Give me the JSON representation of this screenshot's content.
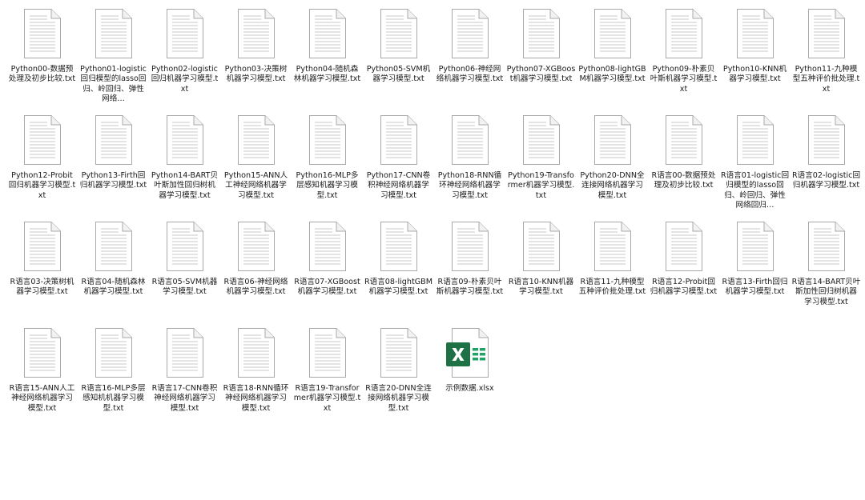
{
  "window": {
    "view": "large-icons"
  },
  "files": [
    {
      "name": "Python00-数据预处理及初步比较.txt",
      "icon": "text-file-icon"
    },
    {
      "name": "Python01-logistic回归模型的lasso回归、岭回归、弹性网络…",
      "icon": "text-file-icon"
    },
    {
      "name": "Python02-logistic回归机器学习模型.txt",
      "icon": "text-file-icon"
    },
    {
      "name": "Python03-决策树机器学习模型.txt",
      "icon": "text-file-icon"
    },
    {
      "name": "Python04-随机森林机器学习模型.txt",
      "icon": "text-file-icon"
    },
    {
      "name": "Python05-SVM机器学习模型.txt",
      "icon": "text-file-icon"
    },
    {
      "name": "Python06-神经网络机器学习模型.txt",
      "icon": "text-file-icon"
    },
    {
      "name": "Python07-XGBoost机器学习模型.txt",
      "icon": "text-file-icon"
    },
    {
      "name": "Python08-lightGBM机器学习模型.txt",
      "icon": "text-file-icon"
    },
    {
      "name": "Python09-朴素贝叶斯机器学习模型.txt",
      "icon": "text-file-icon"
    },
    {
      "name": "Python10-KNN机器学习模型.txt",
      "icon": "text-file-icon"
    },
    {
      "name": "Python11-九种模型五种评价批处理.txt",
      "icon": "text-file-icon"
    },
    {
      "name": "Python12-Probit回归机器学习模型.txt",
      "icon": "text-file-icon"
    },
    {
      "name": "Python13-Firth回归机器学习模型.txt",
      "icon": "text-file-icon"
    },
    {
      "name": "Python14-BART贝叶斯加性回归树机器学习模型.txt",
      "icon": "text-file-icon"
    },
    {
      "name": "Python15-ANN人工神经网络机器学习模型.txt",
      "icon": "text-file-icon"
    },
    {
      "name": "Python16-MLP多层感知机器学习模型.txt",
      "icon": "text-file-icon"
    },
    {
      "name": "Python17-CNN卷积神经网络机器学习模型.txt",
      "icon": "text-file-icon"
    },
    {
      "name": "Python18-RNN循环神经网络机器学习模型.txt",
      "icon": "text-file-icon"
    },
    {
      "name": "Python19-Transformer机器学习模型.txt",
      "icon": "text-file-icon"
    },
    {
      "name": "Python20-DNN全连接网络机器学习模型.txt",
      "icon": "text-file-icon"
    },
    {
      "name": "R语言00-数据预处理及初步比较.txt",
      "icon": "text-file-icon"
    },
    {
      "name": "R语言01-logistic回归模型的lasso回归、岭回归、弹性网络回归…",
      "icon": "text-file-icon"
    },
    {
      "name": "R语言02-logistic回归机器学习模型.txt",
      "icon": "text-file-icon"
    },
    {
      "name": "R语言03-决策树机器学习模型.txt",
      "icon": "text-file-icon"
    },
    {
      "name": "R语言04-随机森林机器学习模型.txt",
      "icon": "text-file-icon"
    },
    {
      "name": "R语言05-SVM机器学习模型.txt",
      "icon": "text-file-icon"
    },
    {
      "name": "R语言06-神经网络机器学习模型.txt",
      "icon": "text-file-icon"
    },
    {
      "name": "R语言07-XGBoost机器学习模型.txt",
      "icon": "text-file-icon"
    },
    {
      "name": "R语言08-lightGBM机器学习模型.txt",
      "icon": "text-file-icon"
    },
    {
      "name": "R语言09-朴素贝叶斯机器学习模型.txt",
      "icon": "text-file-icon"
    },
    {
      "name": "R语言10-KNN机器学习模型.txt",
      "icon": "text-file-icon"
    },
    {
      "name": "R语言11-九种模型五种评价批处理.txt",
      "icon": "text-file-icon"
    },
    {
      "name": "R语言12-Probit回归机器学习模型.txt",
      "icon": "text-file-icon"
    },
    {
      "name": "R语言13-Firth回归机器学习模型.txt",
      "icon": "text-file-icon"
    },
    {
      "name": "R语言14-BART贝叶斯加性回归树机器学习模型.txt",
      "icon": "text-file-icon"
    },
    {
      "name": "R语言15-ANN人工神经网络机器学习模型.txt",
      "icon": "text-file-icon"
    },
    {
      "name": "R语言16-MLP多层感知机机器学习模型.txt",
      "icon": "text-file-icon"
    },
    {
      "name": "R语言17-CNN卷积神经网络机器学习模型.txt",
      "icon": "text-file-icon"
    },
    {
      "name": "R语言18-RNN循环神经网络机器学习模型.txt",
      "icon": "text-file-icon"
    },
    {
      "name": "R语言19-Transformer机器学习模型.txt",
      "icon": "text-file-icon"
    },
    {
      "name": "R语言20-DNN全连接网络机器学习模型.txt",
      "icon": "text-file-icon"
    },
    {
      "name": "示例数据.xlsx",
      "icon": "excel-file-icon"
    }
  ],
  "colors": {
    "excel_green": "#1e7145",
    "excel_light_green": "#21a366",
    "text_line": "#c8c8c8",
    "page_border": "#a9a9a9"
  }
}
